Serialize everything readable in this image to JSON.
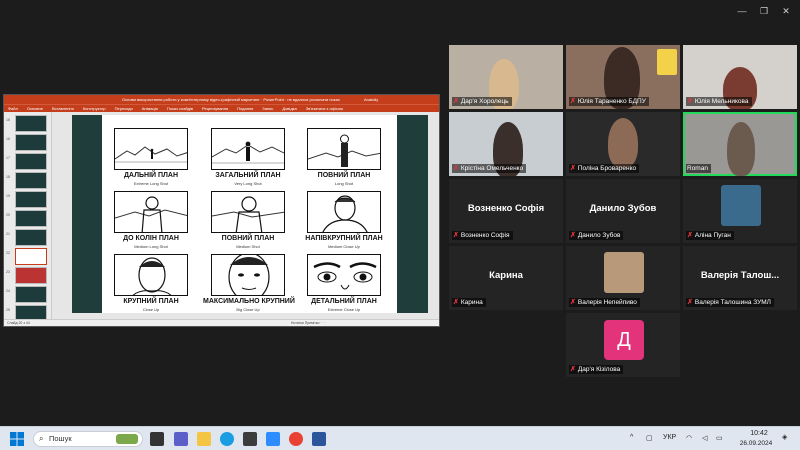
{
  "window_controls": {
    "minimize": "—",
    "restore": "❐",
    "close": "✕"
  },
  "ppt": {
    "title": "Основи використання роботи у комп'ютерному відео-графічний маркетинг · PowerPoint · не вдалося розпочати показ",
    "user": "Anatoliy",
    "menu": [
      "Файл",
      "Основне",
      "Вставлення",
      "Конструктор",
      "Переходи",
      "Анімація",
      "Показ слайдів",
      "Рецензування",
      "Подання",
      "Запис",
      "Довідка",
      "Зв'язатися з офісом"
    ],
    "slide_numbers": [
      "15",
      "16",
      "17",
      "18",
      "19",
      "20",
      "21",
      "22",
      "23",
      "24",
      "25"
    ],
    "status_left": "Слайд 20 з 44",
    "status_right": "Нотатки   Примітки   ·   ·   ·"
  },
  "slide": {
    "shots": [
      {
        "title": "ДАЛЬНІЙ ПЛАН",
        "sub": "Extreme Long Shot"
      },
      {
        "title": "ЗАГАЛЬНИЙ ПЛАН",
        "sub": "Very Long Shot"
      },
      {
        "title": "ПОВНИЙ ПЛАН",
        "sub": "Long Shot"
      },
      {
        "title": "ДО КОЛІН ПЛАН",
        "sub": "Medium Long Shot"
      },
      {
        "title": "ПОВНИЙ ПЛАН",
        "sub": "Medium Shot"
      },
      {
        "title": "НАПІВКРУПНИЙ ПЛАН",
        "sub": "Medium Close Up"
      },
      {
        "title": "КРУПНИЙ ПЛАН",
        "sub": "Close Up"
      },
      {
        "title": "МАКСИМАЛЬНО КРУПНИЙ",
        "sub": "Big Close Up"
      },
      {
        "title": "ДЕТАЛЬНИЙ ПЛАН",
        "sub": "Extreme Close Up"
      }
    ]
  },
  "participants": [
    {
      "name": "Дар'я Хоролець",
      "type": "video"
    },
    {
      "name": "Юлія Тараненко БДПУ",
      "type": "video"
    },
    {
      "name": "Юлія Мельникова",
      "type": "video"
    },
    {
      "name": "Крістіна Омельченко",
      "type": "video"
    },
    {
      "name": "Поліна Броваренко",
      "type": "video"
    },
    {
      "name": "Roman",
      "type": "video"
    },
    {
      "name": "Возненко Софія",
      "display": "Возненко Софія",
      "type": "name"
    },
    {
      "name": "Данило Зубов",
      "display": "Данило Зубов",
      "type": "name"
    },
    {
      "name": "Аліна Пуган",
      "type": "avatar"
    },
    {
      "name": "Карина",
      "display": "Карина",
      "type": "name"
    },
    {
      "name": "Валерія Непейпиво",
      "type": "avatar"
    },
    {
      "name": "Валерія Талошина ЗУМЛ",
      "display": "Валерія  Талош...",
      "type": "name"
    },
    {
      "name": "Дар'я Кізілова",
      "initial": "Д",
      "type": "initial"
    }
  ],
  "taskbar": {
    "search_placeholder": "Пошук",
    "language": "УКР",
    "time": "10:42",
    "date": "26.09.2024",
    "colors": {
      "accent": "#0067c0"
    }
  }
}
